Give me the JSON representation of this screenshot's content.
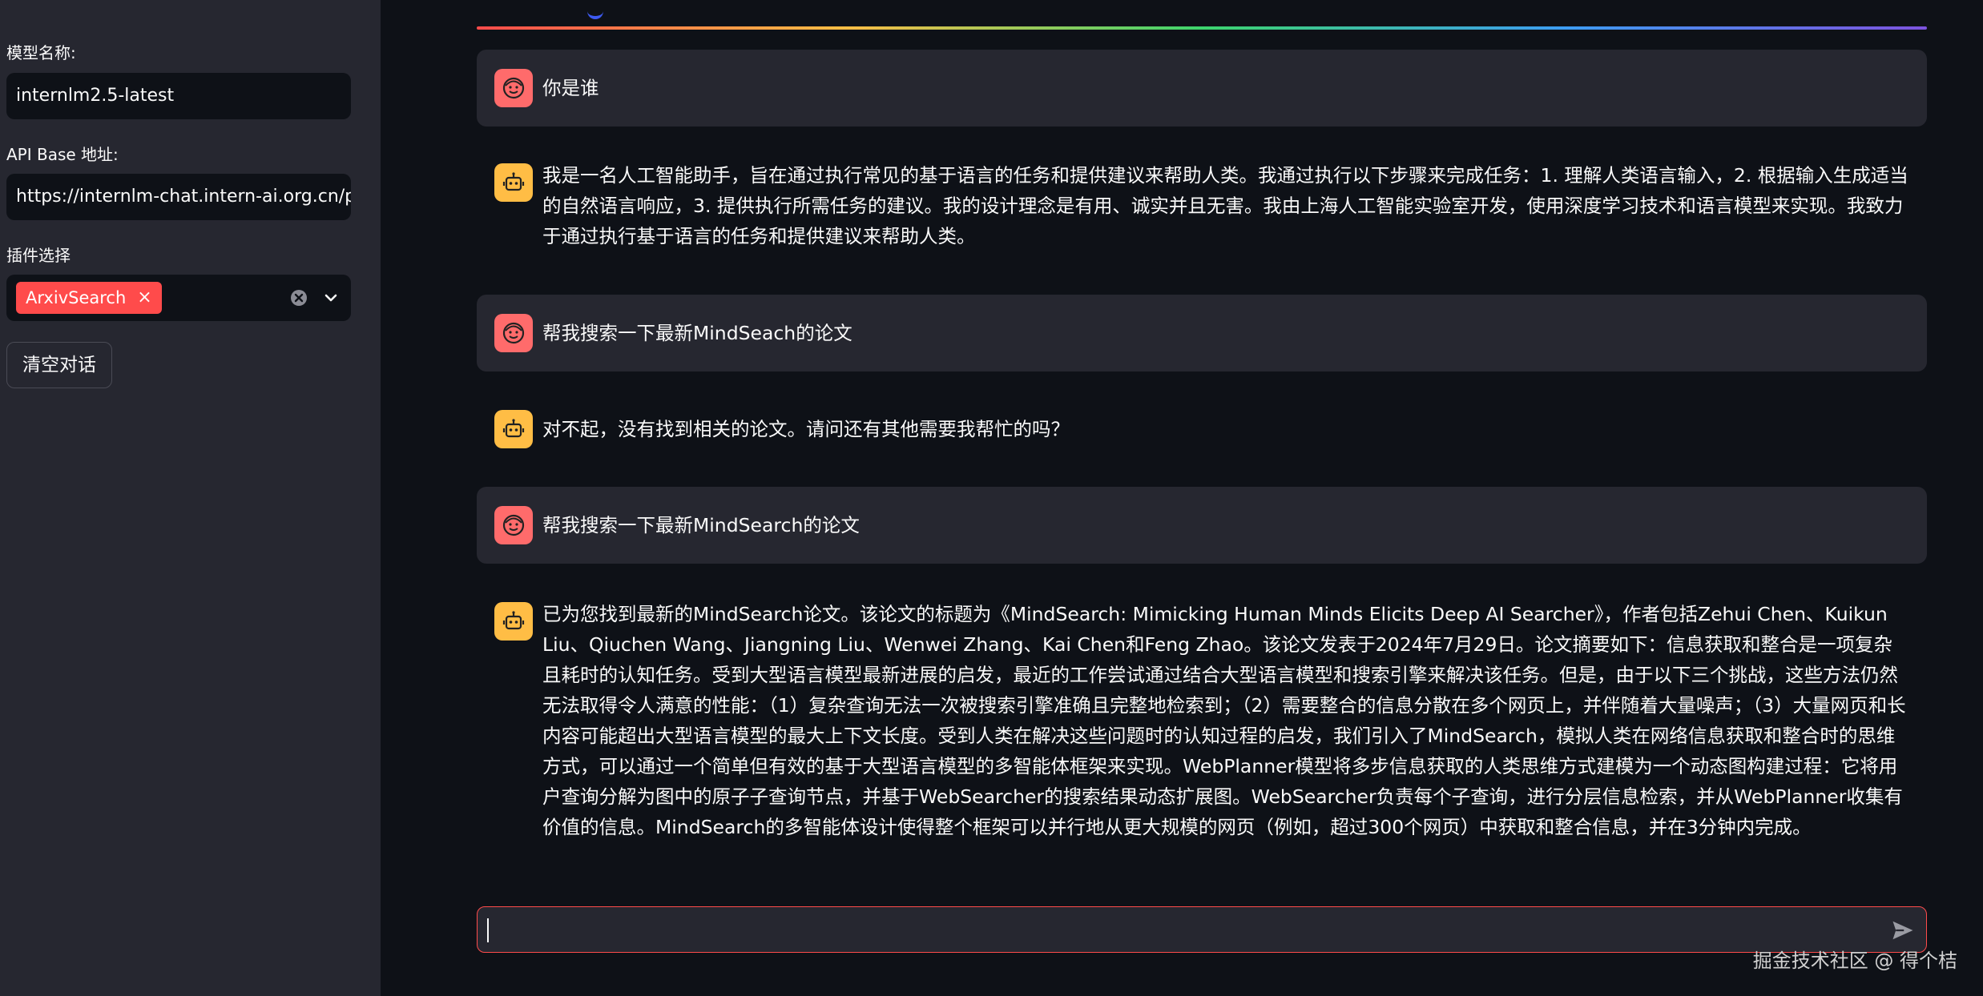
{
  "sidebar": {
    "model_label": "模型名称:",
    "model_value": "internlm2.5-latest",
    "api_label": "API Base 地址:",
    "api_value": "https://internlm-chat.intern-ai.org.cn/pu",
    "plugin_label": "插件选择",
    "plugin_tags": [
      "ArxivSearch"
    ],
    "tag_remove": "×",
    "clear_button": "清空对话"
  },
  "messages": [
    {
      "role": "user",
      "text": "你是谁"
    },
    {
      "role": "assistant",
      "text": "我是一名人工智能助手，旨在通过执行常见的基于语言的任务和提供建议来帮助人类。我通过执行以下步骤来完成任务：1. 理解人类语言输入，2. 根据输入生成适当的自然语言响应，3. 提供执行所需任务的建议。我的设计理念是有用、诚实并且无害。我由上海人工智能实验室开发，使用深度学习技术和语言模型来实现。我致力于通过执行基于语言的任务和提供建议来帮助人类。"
    },
    {
      "role": "user",
      "text": "帮我搜索一下最新MindSeach的论文"
    },
    {
      "role": "assistant",
      "text": "对不起，没有找到相关的论文。请问还有其他需要我帮忙的吗？"
    },
    {
      "role": "user",
      "text": "帮我搜索一下最新MindSearch的论文"
    },
    {
      "role": "assistant",
      "text": "已为您找到最新的MindSearch论文。该论文的标题为《MindSearch: Mimicking Human Minds Elicits Deep AI Searcher》，作者包括Zehui Chen、Kuikun Liu、Qiuchen Wang、Jiangning Liu、Wenwei Zhang、Kai Chen和Feng Zhao。该论文发表于2024年7月29日。论文摘要如下：信息获取和整合是一项复杂且耗时的认知任务。受到大型语言模型最新进展的启发，最近的工作尝试通过结合大型语言模型和搜索引擎来解决该任务。但是，由于以下三个挑战，这些方法仍然无法取得令人满意的性能：（1）复杂查询无法一次被搜索引擎准确且完整地检索到；（2）需要整合的信息分散在多个网页上，并伴随着大量噪声；（3）大量网页和长内容可能超出大型语言模型的最大上下文长度。受到人类在解决这些问题时的认知过程的启发，我们引入了MindSearch，模拟人类在网络信息获取和整合时的思维方式，可以通过一个简单但有效的基于大型语言模型的多智能体框架来实现。WebPlanner模型将多步信息获取的人类思维方式建模为一个动态图构建过程：它将用户查询分解为图中的原子子查询节点，并基于WebSearcher的搜索结果动态扩展图。WebSearcher负责每个子查询，进行分层信息检索，并从WebPlanner收集有价值的信息。MindSearch的多智能体设计使得整个框架可以并行地从更大规模的网页（例如，超过300个网页）中获取和整合信息，并在3分钟内完成。"
    }
  ],
  "chat_input": {
    "value": ""
  },
  "watermark": "掘金技术社区 @ 得个桔",
  "colors": {
    "accent": "#ff4b4b",
    "user_avatar": "#ff6b6b",
    "bot_avatar": "#ffbd45"
  }
}
